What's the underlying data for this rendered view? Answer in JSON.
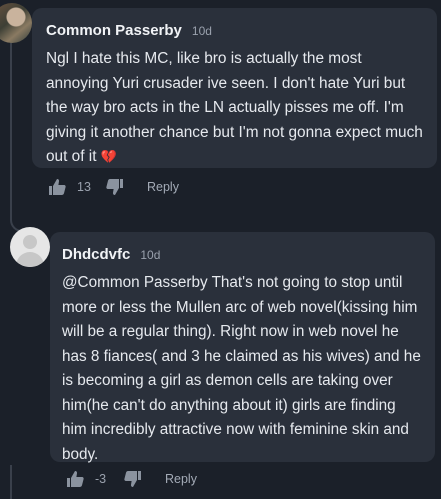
{
  "comments": [
    {
      "author": "Common Passerby",
      "time": "10d",
      "text": "Ngl I hate this MC, like bro is actually the most annoying Yuri crusader ive seen. I don't hate Yuri but the way bro acts in the LN actually pisses me off. I'm giving it another chance but I'm not gonna expect much out of it",
      "emoji": "💔",
      "likes": "13",
      "reply_label": "Reply"
    },
    {
      "author": "Dhdcdvfc",
      "time": "10d",
      "text": "@Common Passerby That's not going to stop until more or less the Mullen arc of web novel(kissing him will be a regular thing). Right now in web novel he has 8 fiances( and 3 he claimed as his wives) and he is becoming a girl as demon cells are taking over him(he can't do anything about it) girls are finding him incredibly attractive now with feminine skin and body.",
      "likes": "-3",
      "reply_label": "Reply"
    }
  ],
  "icons": {
    "like": "thumbs-up-icon",
    "dislike": "thumbs-down-icon"
  },
  "colors": {
    "background": "#1b2029",
    "bubble": "#2a303b",
    "heart": "#e0344c"
  }
}
